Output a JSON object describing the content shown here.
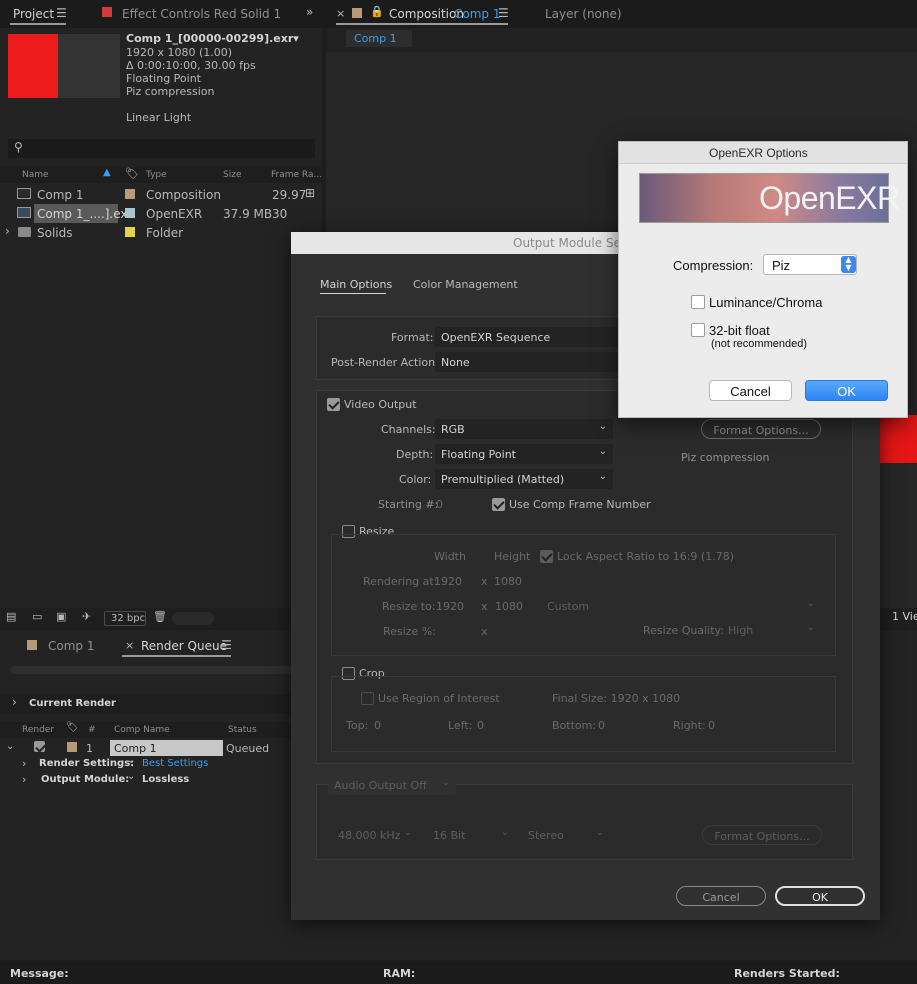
{
  "project_panel": {
    "tab_project": "Project",
    "tab_effect_controls": "Effect Controls Red Solid 1",
    "item_name": "Comp 1_[00000-00299].exr▾",
    "item_resolution": "1920 x 1080 (1.00)",
    "item_duration": "Δ 0:00:10:00, 30.00 fps",
    "item_depth": "Floating Point",
    "item_compression": "Piz compression",
    "item_color": "Linear Light",
    "search_placeholder": "",
    "columns": {
      "name": "Name",
      "type": "Type",
      "size": "Size",
      "frame_rate": "Frame Ra..."
    },
    "rows": [
      {
        "name": "Comp 1",
        "type": "Composition",
        "size": "",
        "fps": "29.97",
        "label_color": "#b79a77"
      },
      {
        "name": "Comp 1_....].exr",
        "type": "OpenEXR",
        "size": "37.9 MB",
        "fps": "30",
        "label_color": "#a7c5cf"
      },
      {
        "name": "Solids",
        "type": "Folder",
        "size": "",
        "fps": "",
        "label_color": "#e3d24a"
      }
    ],
    "bpc": "32 bpc"
  },
  "composition_panel": {
    "tab_prefix": "Composition",
    "tab_comp": "Comp 1",
    "tab_layer": "Layer (none)",
    "subtab": "Comp 1",
    "view_label": "1 Vie"
  },
  "render_queue": {
    "tab_comp": "Comp 1",
    "tab_render_queue": "Render Queue",
    "current_render": "Current Render",
    "col_render": "Render",
    "col_num": "#",
    "col_comp_name": "Comp Name",
    "col_status": "Status",
    "row_num": "1",
    "row_comp": "Comp 1",
    "row_status": "Queued",
    "render_settings_label": "Render Settings:",
    "render_settings_value": "Best Settings",
    "output_module_label": "Output Module:",
    "output_module_value": "Lossless"
  },
  "status_bar": {
    "message": "Message:",
    "ram": "RAM:",
    "renders_started": "Renders Started:"
  },
  "output_module": {
    "title": "Output Module Se",
    "tab_main": "Main Options",
    "tab_color": "Color Management",
    "format_label": "Format:",
    "format_value": "OpenEXR Sequence",
    "post_render_label": "Post-Render Action:",
    "post_render_value": "None",
    "video_output": "Video Output",
    "channels_label": "Channels:",
    "channels_value": "RGB",
    "depth_label": "Depth:",
    "depth_value": "Floating Point",
    "color_label": "Color:",
    "color_value": "Premultiplied (Matted)",
    "starting_label": "Starting #:",
    "starting_value": "0",
    "use_comp_frame": "Use Comp Frame Number",
    "format_options": "Format Options...",
    "format_summary": "Piz compression",
    "resize": "Resize",
    "width": "Width",
    "height": "Height",
    "lock_aspect": "Lock Aspect Ratio to 16:9 (1.78)",
    "rendering_at": "Rendering at:",
    "rendering_w": "1920",
    "rendering_h": "1080",
    "resize_to": "Resize to:",
    "resize_to_w": "1920",
    "resize_to_h": "1080",
    "resize_preset": "Custom",
    "resize_pct": "Resize %:",
    "x": "x",
    "resize_quality_label": "Resize Quality:",
    "resize_quality_value": "High",
    "crop": "Crop",
    "use_roi": "Use Region of Interest",
    "final_size": "Final Size: 1920 x 1080",
    "top": "Top:",
    "top_v": "0",
    "left": "Left:",
    "left_v": "0",
    "bottom": "Bottom:",
    "bottom_v": "0",
    "right": "Right:",
    "right_v": "0",
    "audio_output": "Audio Output Off",
    "audio_rate": "48.000 kHz",
    "audio_bits": "16 Bit",
    "audio_channels": "Stereo",
    "audio_format_options": "Format Options...",
    "cancel": "Cancel",
    "ok": "OK"
  },
  "openexr": {
    "title": "OpenEXR Options",
    "logo_text": "OpenEXR",
    "compression_label": "Compression:",
    "compression_value": "Piz",
    "luminance": "Luminance/Chroma",
    "float32": "32-bit float",
    "not_recommended": "(not recommended)",
    "cancel": "Cancel",
    "ok": "OK"
  }
}
